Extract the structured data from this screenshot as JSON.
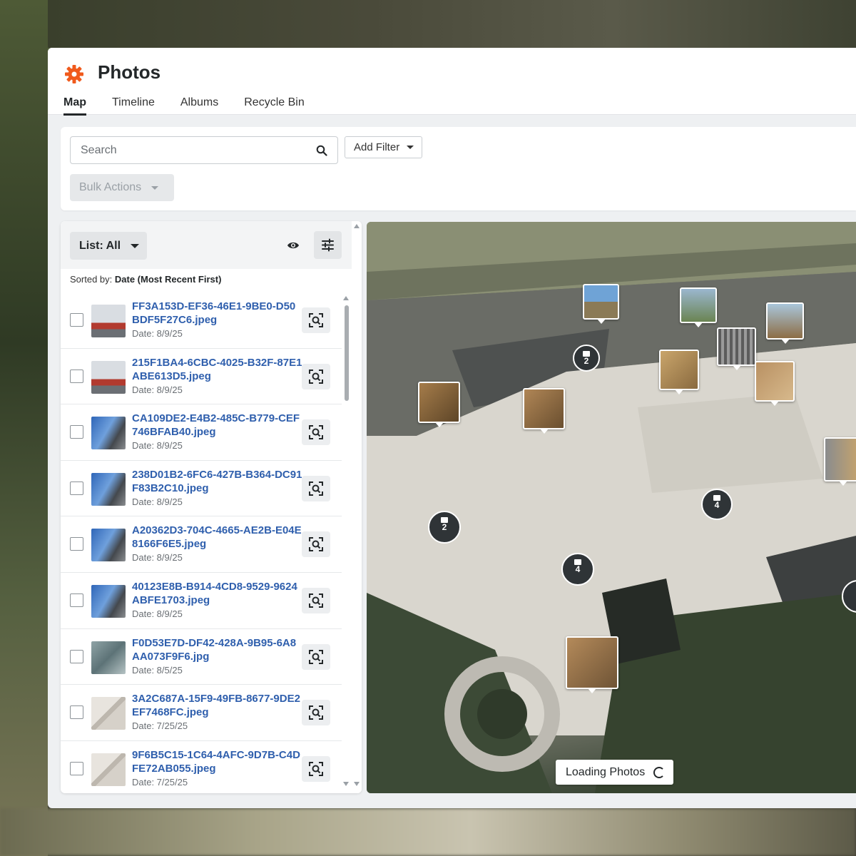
{
  "app": {
    "title": "Photos",
    "accent": "#f05a1c"
  },
  "tabs": [
    {
      "label": "Map",
      "active": true
    },
    {
      "label": "Timeline",
      "active": false
    },
    {
      "label": "Albums",
      "active": false
    },
    {
      "label": "Recycle Bin",
      "active": false
    }
  ],
  "toolbar": {
    "search_placeholder": "Search",
    "add_filter_label": "Add Filter",
    "bulk_actions_label": "Bulk Actions"
  },
  "list_panel": {
    "list_select_label": "List: All",
    "sorted_prefix": "Sorted by:",
    "sorted_value": "Date (Most Recent First)",
    "items": [
      {
        "name": "FF3A153D-EF36-46E1-9BE0-D50BDF5F27C6.jpeg",
        "date": "Date: 8/9/25",
        "thumb": "building"
      },
      {
        "name": "215F1BA4-6CBC-4025-B32F-87E1ABE613D5.jpeg",
        "date": "Date: 8/9/25",
        "thumb": "building"
      },
      {
        "name": "CA109DE2-E4B2-485C-B779-CEF746BFAB40.jpeg",
        "date": "Date: 8/9/25",
        "thumb": "sky"
      },
      {
        "name": "238D01B2-6FC6-427B-B364-DC91F83B2C10.jpeg",
        "date": "Date: 8/9/25",
        "thumb": "sky"
      },
      {
        "name": "A20362D3-704C-4665-AE2B-E04E8166F6E5.jpeg",
        "date": "Date: 8/9/25",
        "thumb": "sky"
      },
      {
        "name": "40123E8B-B914-4CD8-9529-9624ABFE1703.jpeg",
        "date": "Date: 8/9/25",
        "thumb": "sky"
      },
      {
        "name": "F0D53E7D-DF42-428A-9B95-6A8AA073F9F6.jpg",
        "date": "Date: 8/5/25",
        "thumb": "glass"
      },
      {
        "name": "3A2C687A-15F9-49FB-8677-9DE2EF7468FC.jpeg",
        "date": "Date: 7/25/25",
        "thumb": "room"
      },
      {
        "name": "9F6B5C15-1C64-4AFC-9D7B-C4DFE72AB055.jpeg",
        "date": "Date: 7/25/25",
        "thumb": "room"
      }
    ]
  },
  "map": {
    "loading_label": "Loading Photos",
    "clusters": [
      "2",
      "2",
      "4",
      "4"
    ]
  }
}
